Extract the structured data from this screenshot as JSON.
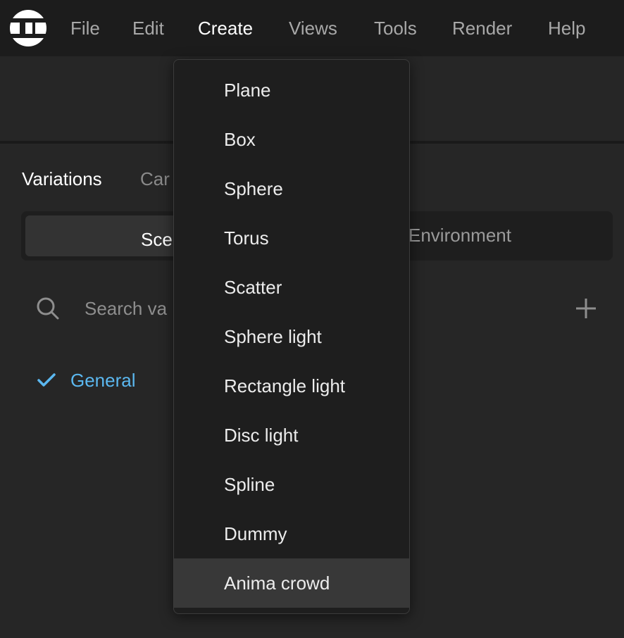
{
  "menubar": {
    "logo_icon": "app-logo-icon",
    "items": [
      {
        "label": "File"
      },
      {
        "label": "Edit"
      },
      {
        "label": "Create"
      },
      {
        "label": "Views"
      },
      {
        "label": "Tools"
      },
      {
        "label": "Render"
      },
      {
        "label": "Help"
      }
    ],
    "active": "Create"
  },
  "panel": {
    "tabs": [
      {
        "label": "Variations"
      },
      {
        "label": "Car"
      }
    ],
    "segmented": {
      "left_label": "Sce",
      "right_label": "Environment"
    },
    "search": {
      "icon": "search-icon",
      "placeholder": "Search va",
      "value": ""
    },
    "add_icon": "plus-icon",
    "variations": [
      {
        "label": "General",
        "checked": true,
        "icon": "check-icon"
      }
    ]
  },
  "create_menu": {
    "items": [
      {
        "label": "Plane"
      },
      {
        "label": "Box"
      },
      {
        "label": "Sphere"
      },
      {
        "label": "Torus"
      },
      {
        "label": "Scatter"
      },
      {
        "label": "Sphere light"
      },
      {
        "label": "Rectangle light"
      },
      {
        "label": "Disc light"
      },
      {
        "label": "Spline"
      },
      {
        "label": "Dummy"
      },
      {
        "label": "Anima crowd"
      }
    ],
    "highlighted": "Anima crowd"
  },
  "colors": {
    "background": "#262626",
    "menubar": "#1c1c1c",
    "accent": "#5bb8f0",
    "menu_bg": "#1e1e1e",
    "menu_highlight": "#383838"
  }
}
